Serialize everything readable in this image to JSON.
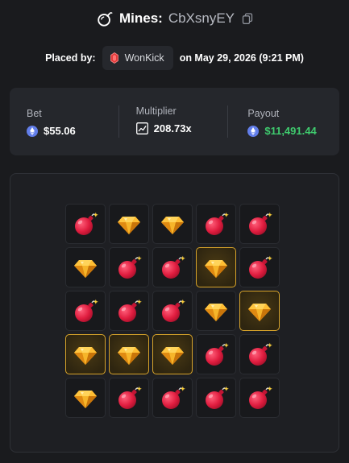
{
  "header": {
    "title": "Mines:",
    "game_id": "CbXsnyEY",
    "logo_icon": "bomb-icon",
    "copy_icon": "copy-icon"
  },
  "placed": {
    "prefix": "Placed by:",
    "username": "WonKick",
    "suffix": "on May 29, 2026 (9:21 PM)",
    "user_icon": "red-gem-icon"
  },
  "stats": {
    "bet_label": "Bet",
    "bet_value": "$55.06",
    "multiplier_label": "Multiplier",
    "multiplier_value": "208.73x",
    "payout_label": "Payout",
    "payout_value": "$11,491.44"
  },
  "colors": {
    "background": "#1a1b1e",
    "panel": "#25272c",
    "payout_green": "#3fcb6e",
    "picked_border": "#d8a42a",
    "eth_blue": "#627eea"
  },
  "board": {
    "rows": [
      [
        {
          "type": "bomb",
          "picked": false
        },
        {
          "type": "gem",
          "picked": false
        },
        {
          "type": "gem",
          "picked": false
        },
        {
          "type": "bomb",
          "picked": false
        },
        {
          "type": "bomb",
          "picked": false
        }
      ],
      [
        {
          "type": "gem",
          "picked": false
        },
        {
          "type": "bomb",
          "picked": false
        },
        {
          "type": "bomb",
          "picked": false
        },
        {
          "type": "gem",
          "picked": true
        },
        {
          "type": "bomb",
          "picked": false
        }
      ],
      [
        {
          "type": "bomb",
          "picked": false
        },
        {
          "type": "bomb",
          "picked": false
        },
        {
          "type": "bomb",
          "picked": false
        },
        {
          "type": "gem",
          "picked": false
        },
        {
          "type": "gem",
          "picked": true
        }
      ],
      [
        {
          "type": "gem",
          "picked": true
        },
        {
          "type": "gem",
          "picked": true
        },
        {
          "type": "gem",
          "picked": true
        },
        {
          "type": "bomb",
          "picked": false
        },
        {
          "type": "bomb",
          "picked": false
        }
      ],
      [
        {
          "type": "gem",
          "picked": false
        },
        {
          "type": "bomb",
          "picked": false
        },
        {
          "type": "bomb",
          "picked": false
        },
        {
          "type": "bomb",
          "picked": false
        },
        {
          "type": "bomb",
          "picked": false
        }
      ]
    ]
  }
}
